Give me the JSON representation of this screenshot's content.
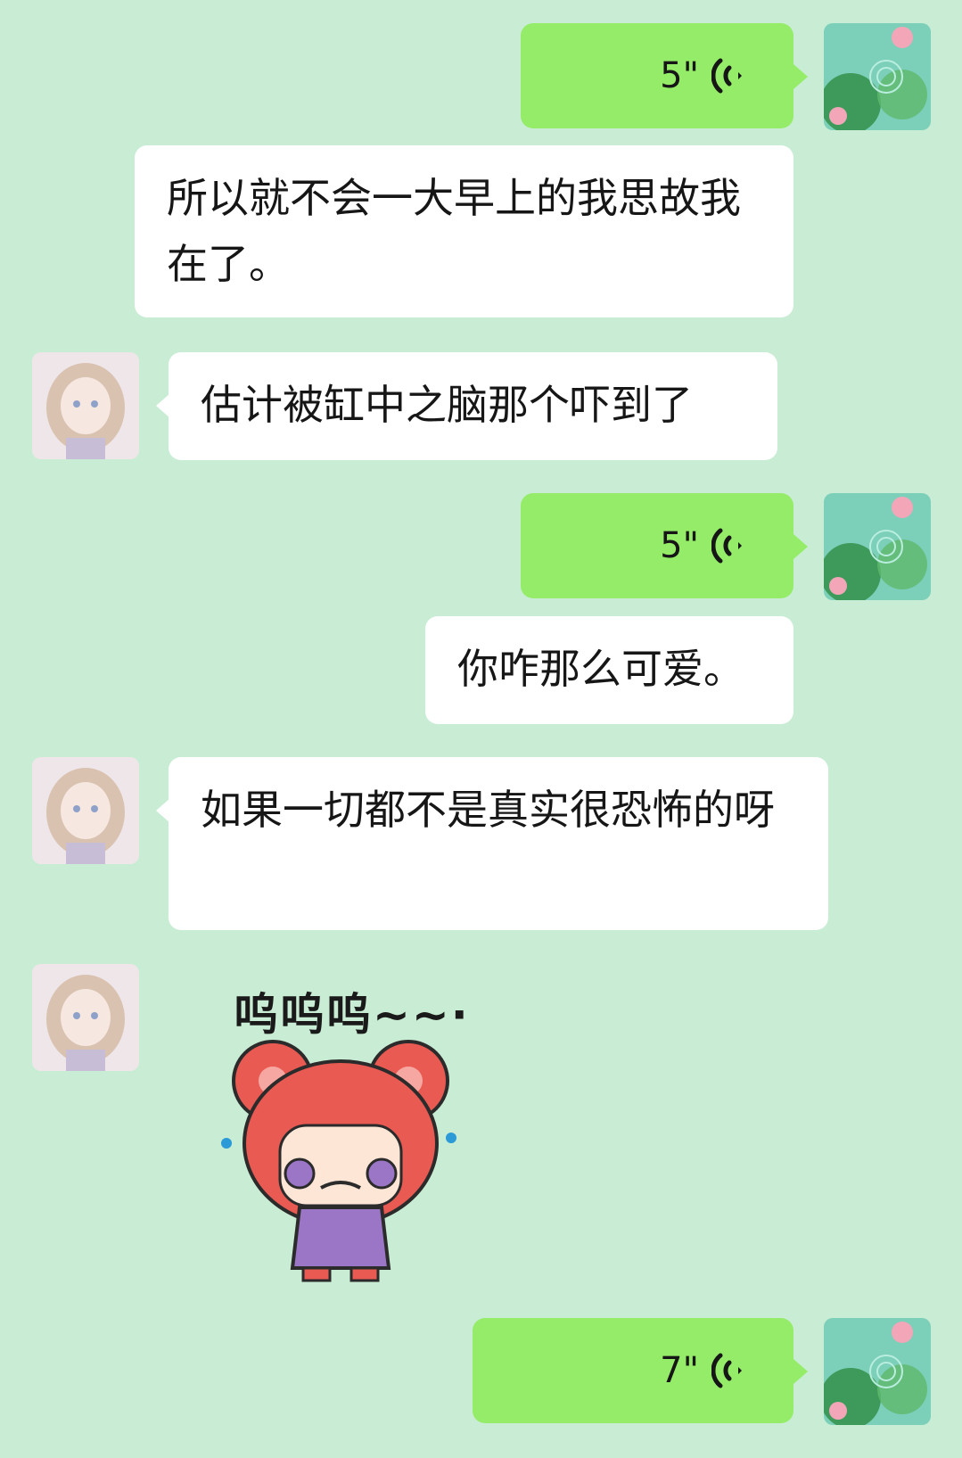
{
  "messages": [
    {
      "type": "voice",
      "side": "right",
      "duration": "5\""
    },
    {
      "type": "text",
      "side": "right",
      "text": "所以就不会一大早上的我思故我在了。"
    },
    {
      "type": "text",
      "side": "left",
      "text": "估计被缸中之脑那个吓到了"
    },
    {
      "type": "voice",
      "side": "right",
      "duration": "5\""
    },
    {
      "type": "text",
      "side": "right",
      "text": "你咋那么可爱。"
    },
    {
      "type": "text",
      "side": "left",
      "text": "如果一切都不是真实很恐怖的呀"
    },
    {
      "type": "sticker",
      "side": "left",
      "caption": "呜呜呜~~·",
      "icon": "crying-girl-sticker"
    },
    {
      "type": "voice",
      "side": "right",
      "duration": "7\""
    }
  ],
  "colors": {
    "background": "#c9edd4",
    "outgoing_bubble": "#95ec69",
    "incoming_bubble": "#ffffff"
  },
  "avatars": {
    "self": "lotus-pond-avatar",
    "contact": "anime-girl-avatar"
  }
}
